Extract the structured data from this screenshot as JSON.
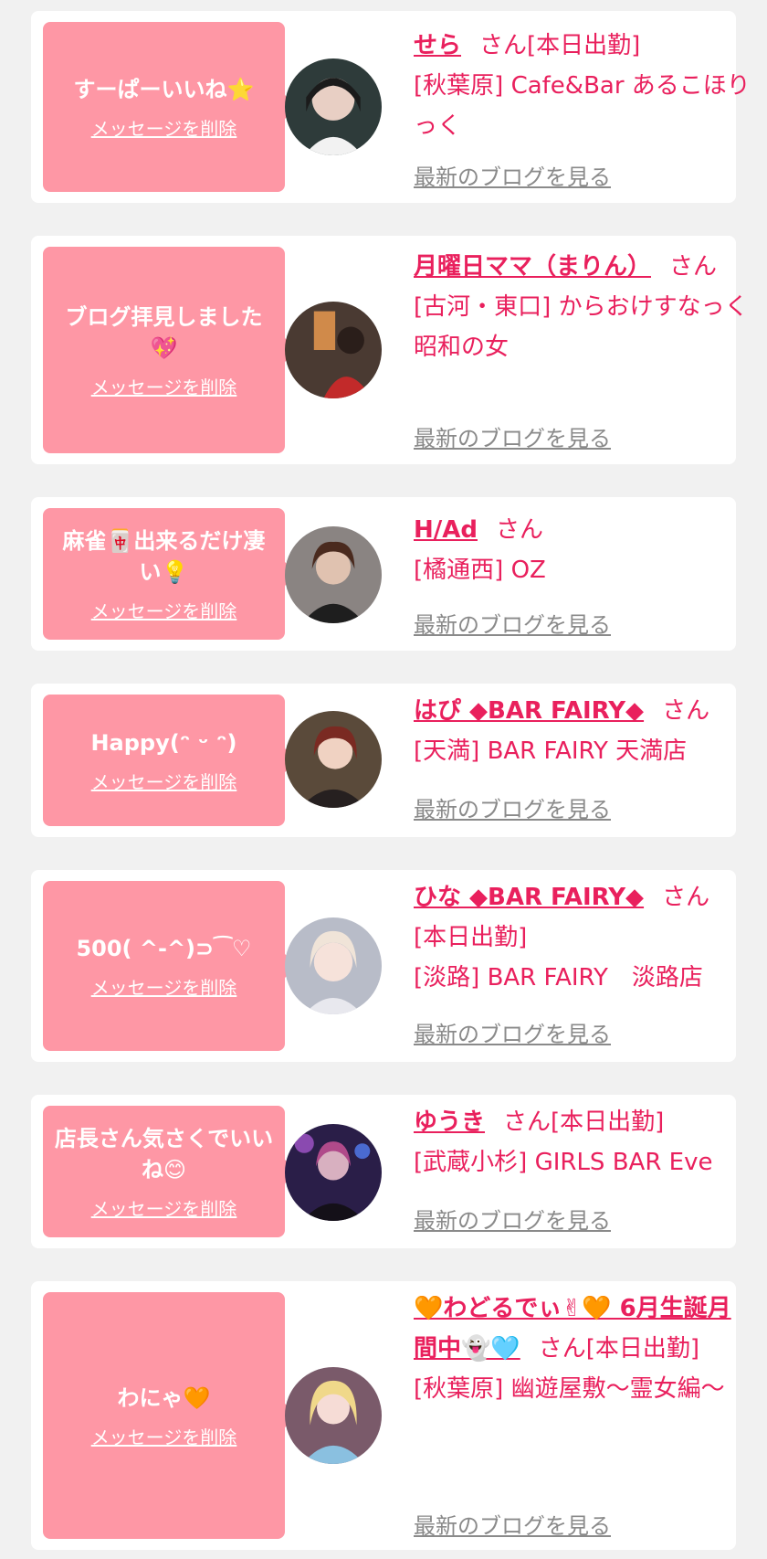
{
  "cards": [
    {
      "message": "すーぱーいいね⭐",
      "delete_label": "メッセージを削除",
      "name": "せら",
      "honorific": "さん",
      "status": "[本日出勤]",
      "area": "[秋葉原]",
      "shop": "Cafe&Bar あるこほりっく",
      "blog_link": "最新のブログを見る"
    },
    {
      "message": "ブログ拝見しました💖",
      "delete_label": "メッセージを削除",
      "name": "月曜日ママ（まりん）",
      "honorific": "さん",
      "status": "",
      "area": "[古河・東口]",
      "shop": "からおけすなっく 昭和の女",
      "blog_link": "最新のブログを見る"
    },
    {
      "message": "麻雀🀄出来るだけ凄い💡",
      "delete_label": "メッセージを削除",
      "name": "H/Ad",
      "honorific": "さん",
      "status": "",
      "area": "[橘通西]",
      "shop": "OZ",
      "blog_link": "最新のブログを見る"
    },
    {
      "message": "Happy(ᵔ ᵕ ᵔ)",
      "delete_label": "メッセージを削除",
      "name": "はぴ ◆BAR FAIRY◆",
      "honorific": "さん",
      "status": "",
      "area": "[天満]",
      "shop": "BAR FAIRY 天満店",
      "blog_link": "最新のブログを見る"
    },
    {
      "message": "500( ^-^)⊃⁀♡",
      "delete_label": "メッセージを削除",
      "name": "ひな ◆BAR FAIRY◆",
      "honorific": "さん",
      "status": "[本日出勤]",
      "area": "[淡路]",
      "shop": "BAR FAIRY　淡路店",
      "blog_link": "最新のブログを見る"
    },
    {
      "message": "店長さん気さくでいいね😊",
      "delete_label": "メッセージを削除",
      "name": "ゆうき",
      "honorific": "さん",
      "status": "[本日出勤]",
      "area": "[武蔵小杉]",
      "shop": "GIRLS BAR Eve",
      "blog_link": "最新のブログを見る"
    },
    {
      "message": "わにゃ🧡",
      "delete_label": "メッセージを削除",
      "name": "🧡わどるでぃ✌🧡 6月生誕月間中👻🩵",
      "honorific": "さん",
      "status": "[本日出勤]",
      "area": "[秋葉原]",
      "shop": "幽遊屋敷〜霊女編〜",
      "blog_link": "最新のブログを見る"
    }
  ],
  "avatar_colors": [
    "#3a4a48",
    "#8a3a2a",
    "#4a4040",
    "#6b3a30",
    "#c8c8d0",
    "#3a2a5a",
    "#c89ab0"
  ]
}
